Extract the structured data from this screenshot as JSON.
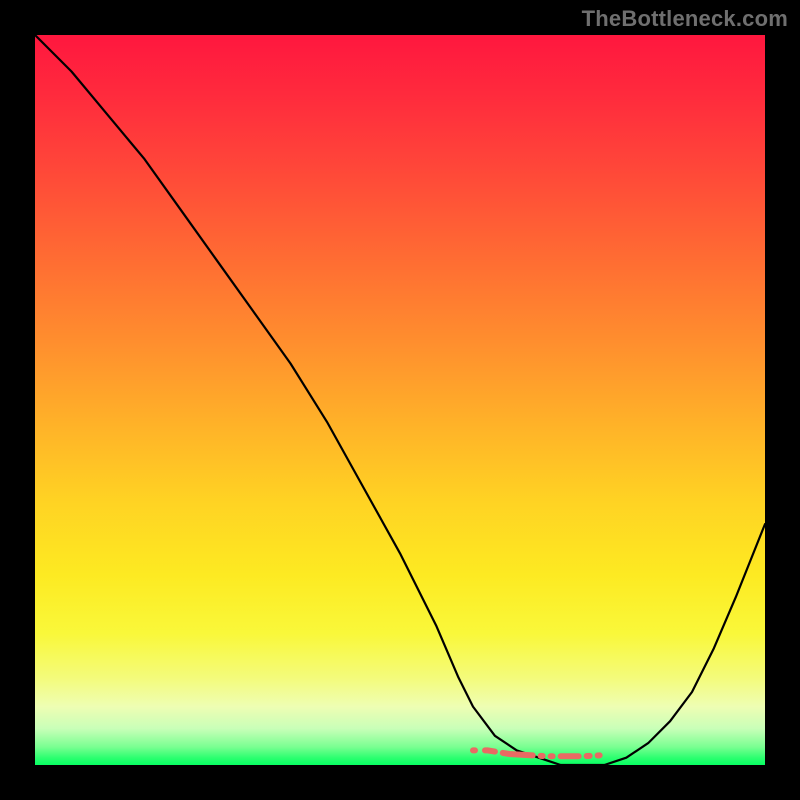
{
  "attribution": "TheBottleneck.com",
  "colors": {
    "frame": "#000000",
    "curve": "#000000",
    "marker": "#e96a63",
    "gradient_top": "#ff173e",
    "gradient_bottom": "#07ff62"
  },
  "chart_data": {
    "type": "line",
    "title": "",
    "xlabel": "",
    "ylabel": "",
    "xlim": [
      0,
      100
    ],
    "ylim": [
      0,
      100
    ],
    "grid": false,
    "background": "vertical-gradient red→green (low values green at bottom)",
    "series": [
      {
        "name": "bottleneck-curve",
        "x": [
          0,
          5,
          10,
          15,
          20,
          25,
          30,
          35,
          40,
          45,
          50,
          55,
          58,
          60,
          63,
          66,
          69,
          72,
          75,
          78,
          81,
          84,
          87,
          90,
          93,
          96,
          100
        ],
        "y": [
          100,
          95,
          89,
          83,
          76,
          69,
          62,
          55,
          47,
          38,
          29,
          19,
          12,
          8,
          4,
          2,
          1,
          0,
          0,
          0,
          1,
          3,
          6,
          10,
          16,
          23,
          33
        ]
      }
    ],
    "highlight": {
      "name": "optimal-range-markers",
      "color": "#e96a63",
      "x": [
        60,
        62,
        65,
        70,
        73,
        75,
        77,
        80,
        82
      ],
      "y": [
        2,
        2,
        1.5,
        1.2,
        1.2,
        1.2,
        1.3,
        1.5,
        2
      ]
    },
    "annotations": []
  }
}
